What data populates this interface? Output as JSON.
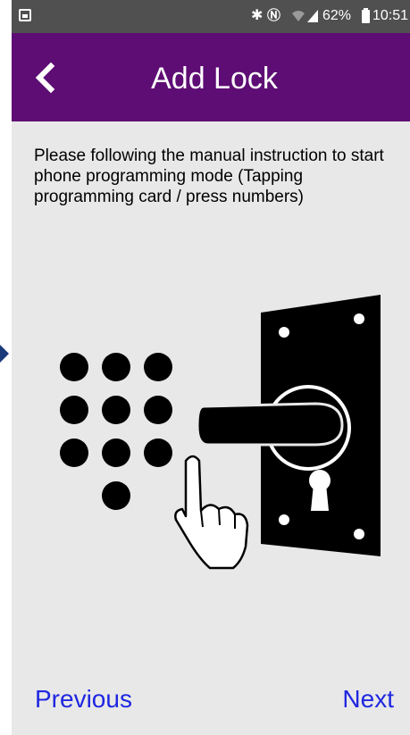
{
  "status_bar": {
    "icons": [
      "screenshot-icon",
      "bluetooth-icon",
      "nfc-icon",
      "wifi-icon",
      "signal-icon",
      "battery-icon"
    ],
    "battery_text": "62%",
    "time": "10:51"
  },
  "app_bar": {
    "back_icon": "chevron-left-icon",
    "title": "Add Lock",
    "background": "#5d0d73"
  },
  "instruction": "Please following the manual instruction to start phone programming mode (Tapping programming card / press numbers)",
  "illustration": {
    "icons": [
      "keypad-icon",
      "finger-pointer-icon",
      "door-handle-icon",
      "keyhole-icon"
    ]
  },
  "footer": {
    "previous_label": "Previous",
    "next_label": "Next",
    "link_color": "#1f27e0"
  }
}
